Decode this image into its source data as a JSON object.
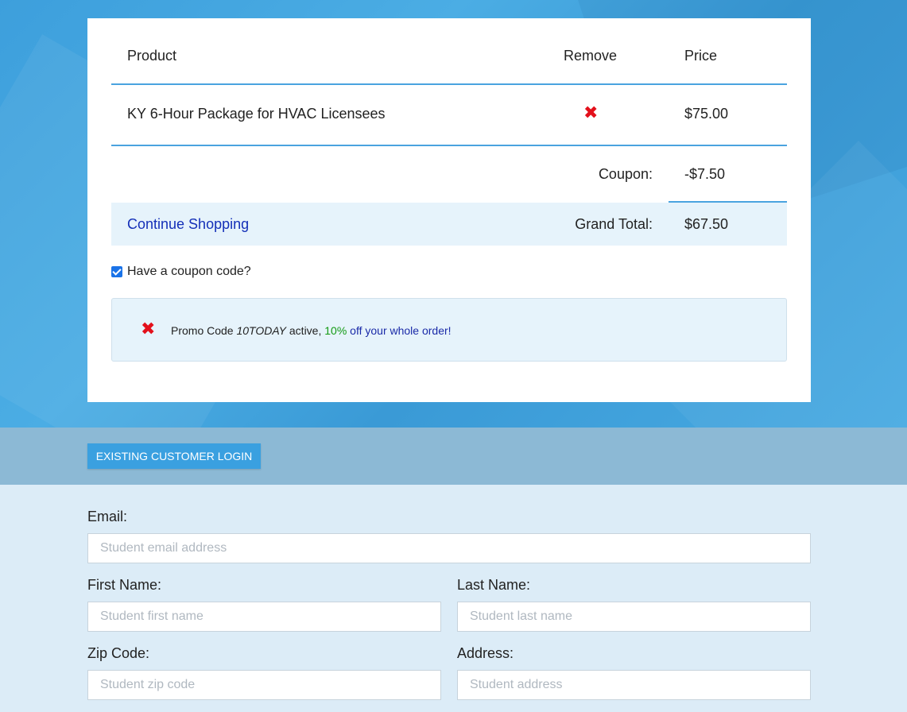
{
  "cart": {
    "headers": {
      "product": "Product",
      "remove": "Remove",
      "price": "Price"
    },
    "item": {
      "name": "KY 6-Hour Package for HVAC Licensees",
      "price": "$75.00"
    },
    "coupon": {
      "label": "Coupon:",
      "value": "-$7.50"
    },
    "total": {
      "continue_label": "Continue Shopping",
      "label": "Grand Total:",
      "value": "$67.50"
    }
  },
  "coupon_toggle": {
    "label": "Have a coupon code?",
    "checked": true
  },
  "promo": {
    "prefix": "Promo Code ",
    "code": "10TODAY",
    "middle": " active, ",
    "percent": "10%",
    "suffix": " off your whole order!"
  },
  "login": {
    "button_label": "EXISTING CUSTOMER LOGIN"
  },
  "form": {
    "email": {
      "label": "Email:",
      "placeholder": "Student email address"
    },
    "first_name": {
      "label": "First Name:",
      "placeholder": "Student first name"
    },
    "last_name": {
      "label": "Last Name:",
      "placeholder": "Student last name"
    },
    "zip": {
      "label": "Zip Code:",
      "placeholder": "Student zip code"
    },
    "address": {
      "label": "Address:",
      "placeholder": "Student address"
    }
  },
  "colors": {
    "accent": "#3aa0e0",
    "divider": "#4aa3df",
    "remove_red": "#e3101b",
    "link_blue": "#1430b8",
    "discount_green": "#139a13"
  },
  "icons": {
    "remove": "close-icon",
    "checkbox": "checkbox-checked-icon"
  }
}
